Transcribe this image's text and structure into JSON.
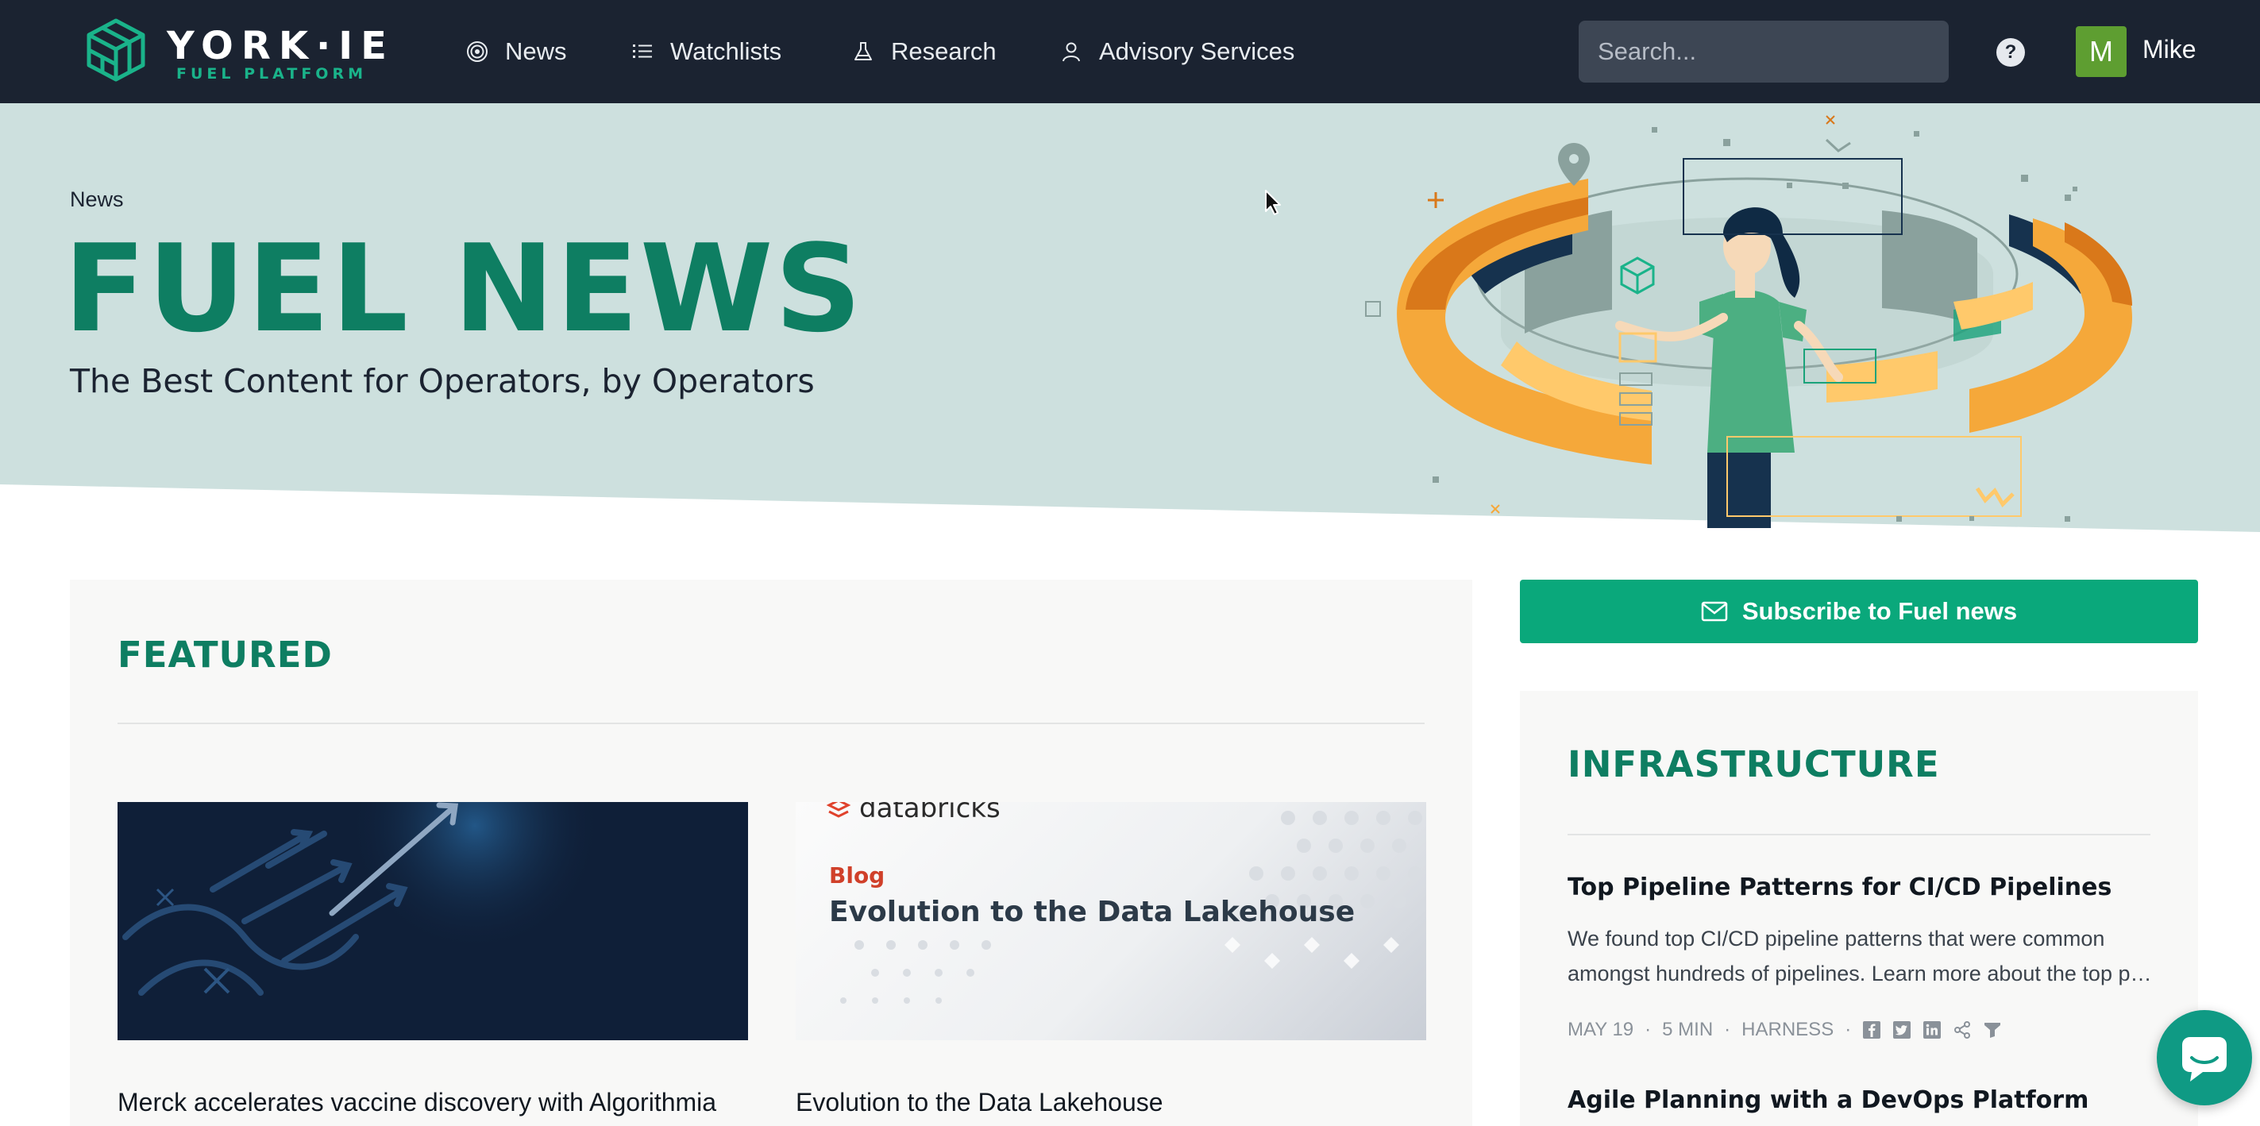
{
  "nav": {
    "logo_word": "YORK·IE",
    "logo_sub": "FUEL PLATFORM",
    "items": [
      {
        "label": "News",
        "icon": "target-icon"
      },
      {
        "label": "Watchlists",
        "icon": "list-icon"
      },
      {
        "label": "Research",
        "icon": "flask-icon"
      },
      {
        "label": "Advisory Services",
        "icon": "person-icon"
      }
    ],
    "search_placeholder": "Search...",
    "help_label": "?",
    "avatar_initial": "M",
    "username": "Mike"
  },
  "hero": {
    "breadcrumb": "News",
    "title": "FUEL NEWS",
    "subtitle": "The Best Content for Operators, by Operators"
  },
  "featured": {
    "title": "FEATURED",
    "cards": [
      {
        "title": "Merck accelerates vaccine discovery with Algorithmia"
      },
      {
        "image_logo": "databricks",
        "image_tag": "Blog",
        "image_title": "Evolution to the Data Lakehouse",
        "title": "Evolution to the Data Lakehouse"
      }
    ]
  },
  "sidebar": {
    "subscribe_label": "Subscribe to Fuel news",
    "section_title": "INFRASTRUCTURE",
    "articles": [
      {
        "title": "Top Pipeline Patterns for CI/CD Pipelines",
        "desc_line1": "We found top CI/CD pipeline patterns that were common",
        "desc_line2": "amongst hundreds of pipelines. Learn more about the top patterns.",
        "date": "MAY 19",
        "read_time": "5 MIN",
        "source": "HARNESS",
        "sep": "·",
        "share_icons": [
          "facebook-icon",
          "twitter-icon",
          "linkedin-icon",
          "share-icon",
          "filter-icon"
        ]
      },
      {
        "title": "Agile Planning with a DevOps Platform"
      }
    ]
  },
  "colors": {
    "nav_bg": "#1b2331",
    "hero_bg": "#cde0de",
    "brand_green": "#0e7e62",
    "button_green": "#0aa87b",
    "accent_orange": "#f5a83a"
  }
}
